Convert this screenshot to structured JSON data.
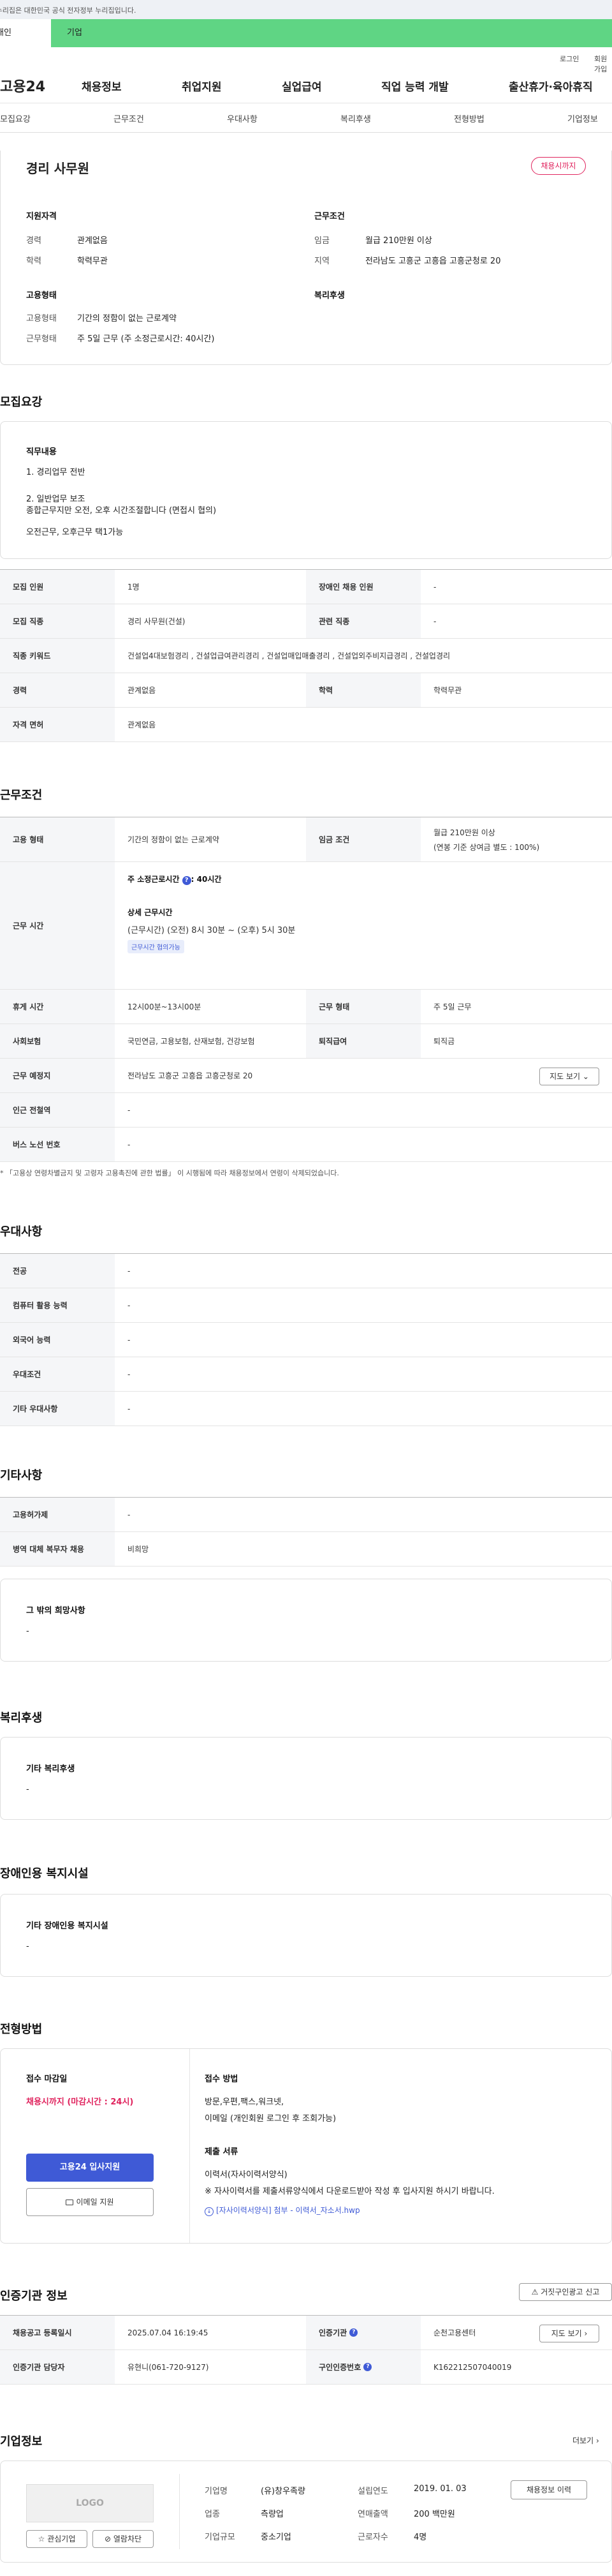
{
  "banner": {
    "text": "이 누리집은 대한민국 공식 전자정부 누리집입니다."
  },
  "tabs": {
    "personal": "개인",
    "company": "기업"
  },
  "util": {
    "login": "로그인",
    "join": "회원가입"
  },
  "gnb": {
    "logo": "고용24",
    "menu": [
      "채용정보",
      "취업지원",
      "실업급여",
      "직업 능력 개발",
      "출산휴가·육아휴직"
    ]
  },
  "anchors": [
    "모집요강",
    "근무조건",
    "우대사항",
    "복리후생",
    "전형방법",
    "기업정보"
  ],
  "summary": {
    "title": "경리 사무원",
    "status": "채용시까지",
    "qual_title": "지원자격",
    "cond_title": "근무조건",
    "emp_title": "고용형태",
    "welfare_title": "복리후생",
    "career_lbl": "경력",
    "career": "관계없음",
    "edu_lbl": "학력",
    "edu": "학력무관",
    "wage_lbl": "임금",
    "wage": "월급 210만원 이상",
    "region_lbl": "지역",
    "region": "전라남도 고흥군 고흥읍 고흥군청로 20",
    "emptype_lbl": "고용형태",
    "emptype": "기간의 정함이 없는 근로계약",
    "worktype_lbl": "근무형태",
    "worktype": "주 5일 근무 (주 소정근로시간: 40시간)"
  },
  "recruit": {
    "title": "모집요강",
    "duty_title": "직무내용",
    "duty_lines": [
      "1. 경리업무 전반",
      "2. 일반업무 보조",
      "종합근무지만 오전, 오후 시간조절합니다 (면접시 협의)",
      "오전근무, 오후근무 택1가능"
    ],
    "rows": [
      {
        "k1": "모집 인원",
        "v1": "1명",
        "k2": "장애인 채용 인원",
        "v2": "-"
      },
      {
        "k1": "모집 직종",
        "v1": "경리 사무원(건설)",
        "k2": "관련 직종",
        "v2": "-"
      },
      {
        "k1": "직종 키워드",
        "v1": "건설업4대보험경리 , 건설업급여관리경리 , 건설업매입매출경리 , 건설업외주비지급경리 , 건설업경리"
      },
      {
        "k1": "경력",
        "v1": "관계없음",
        "k2": "학력",
        "v2": "학력무관"
      },
      {
        "k1": "자격 면허",
        "v1": "관계없음"
      }
    ]
  },
  "work": {
    "title": "근무조건",
    "emp_k": "고용 형태",
    "emp_v": "기간의 정함이 없는 근로계약",
    "wage_k": "임금 조건",
    "wage_v1": "월급 210만원 이상",
    "wage_v2": "(연봉 기준 상여금 별도 : 100%)",
    "time_k": "근무 시간",
    "time_total": "주 소정근로시간",
    "time_total_v": ": 40시간",
    "time_detail_title": "상세 근무시간",
    "time_detail": "(근무시간) (오전) 8시 30분 ~ (오후) 5시 30분",
    "time_badge": "근무시간 협의가능",
    "rest_k": "휴게 시간",
    "rest_v": "12시00분~13시00분",
    "form_k": "근무 형태",
    "form_v": "주 5일 근무",
    "ins_k": "사회보험",
    "ins_v": "국민연금, 고용보험, 산재보험, 건강보험",
    "sev_k": "퇴직급여",
    "sev_v": "퇴직금",
    "place_k": "근무 예정지",
    "place_v": "전라남도 고흥군 고흥읍 고흥군청로 20",
    "map_btn": "지도 보기",
    "station_k": "인근 전철역",
    "station_v": "-",
    "bus_k": "버스 노선 번호",
    "bus_v": "-",
    "note": "* 「고용상 연령차별금지 및 고령자 고용촉진에 관한 법률」 이 시행됨에 따라 채용정보에서 연령이 삭제되었습니다."
  },
  "pref": {
    "title": "우대사항",
    "rows": [
      {
        "k": "전공",
        "v": "-"
      },
      {
        "k": "컴퓨터 활용 능력",
        "v": "-"
      },
      {
        "k": "외국어 능력",
        "v": "-"
      },
      {
        "k": "우대조건",
        "v": "-"
      },
      {
        "k": "기타 우대사항",
        "v": "-"
      }
    ]
  },
  "etc": {
    "title": "기타사항",
    "rows": [
      {
        "k": "고용허가제",
        "v": "-"
      },
      {
        "k": "병역 대체 복무자 채용",
        "v": "비희망"
      }
    ],
    "hope_title": "그 밖의 희망사항",
    "hope_v": "-"
  },
  "welfare": {
    "title": "복리후생",
    "box_title": "기타 복리후생",
    "box_v": "-"
  },
  "disabled": {
    "title": "장애인용 복지시설",
    "box_title": "기타 장애인용 복지시설",
    "box_v": "-"
  },
  "selection": {
    "title": "전형방법",
    "deadline_title": "접수 마감일",
    "deadline_v": "채용시까지 (마감시간 : 24시)",
    "method_title": "접수 방법",
    "method_v1": "방문,우편,팩스,워크넷,",
    "method_v2": "이메일 (개인회원 로그인 후 조회가능)",
    "docs_title": "제출 서류",
    "docs_v1": "이력서(자사이력서양식)",
    "docs_v2": "※ 자사이력서를 제출서류양식에서 다운로드받아 작성 후 입사지원 하시기 바랍니다.",
    "docs_file": "[자사이력서양식] 첨부 - 이력서_자소서.hwp",
    "apply_btn": "고용24 입사지원",
    "email_btn": "이메일 지원"
  },
  "agency": {
    "title": "인증기관 정보",
    "report_btn": "거짓구인광고 신고",
    "reg_k": "채용공고 등록일시",
    "reg_v": "2025.07.04 16:19:45",
    "org_k": "인증기관",
    "org_v": "순천고용센터",
    "map_btn": "지도 보기",
    "mgr_k": "인증기관 담당자",
    "mgr_v": "유현니(061-720-9127)",
    "num_k": "구인인증번호",
    "num_v": "K162212507040019"
  },
  "company": {
    "title": "기업정보",
    "more": "더보기",
    "logo": "LOGO",
    "fav_btn": "관심기업",
    "block_btn": "열람차단",
    "name_k": "기업명",
    "name_v": "(유)창우족량",
    "found_k": "설립연도",
    "found_v": "2019. 01. 03",
    "ind_k": "업종",
    "ind_v": "측량업",
    "sales_k": "연매출액",
    "sales_v": "200 백만원",
    "size_k": "기업규모",
    "size_v": "중소기업",
    "staff_k": "근로자수",
    "staff_v": "4명",
    "jobs_btn": "채용정보 이력"
  },
  "colors": {
    "green": "#5fd584",
    "red": "#e0245e",
    "blue": "#3f5ad6"
  }
}
